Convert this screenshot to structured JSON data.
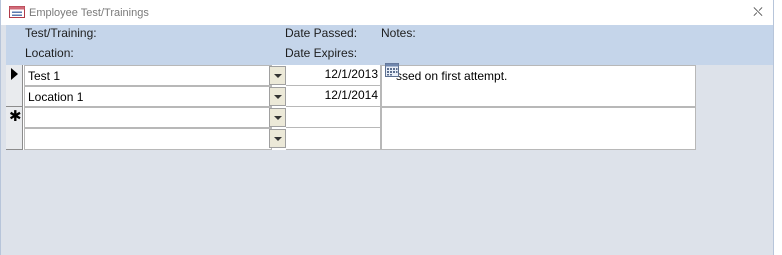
{
  "window": {
    "title": "Employee Test/Trainings"
  },
  "header": {
    "test_training_label": "Test/Training:",
    "location_label": "Location:",
    "date_passed_label": "Date Passed:",
    "date_expires_label": "Date Expires:",
    "notes_label": "Notes:"
  },
  "records": [
    {
      "test_training": "Test 1",
      "location": "Location 1",
      "date_passed": "12/1/2013",
      "date_expires": "12/1/2014",
      "notes": "ssed on first attempt."
    }
  ],
  "icons": {
    "app": "form-icon",
    "close": "close-icon",
    "current_record": "record-pointer-icon",
    "new_record": "new-record-asterisk-icon",
    "calendar": "date-picker-icon"
  }
}
